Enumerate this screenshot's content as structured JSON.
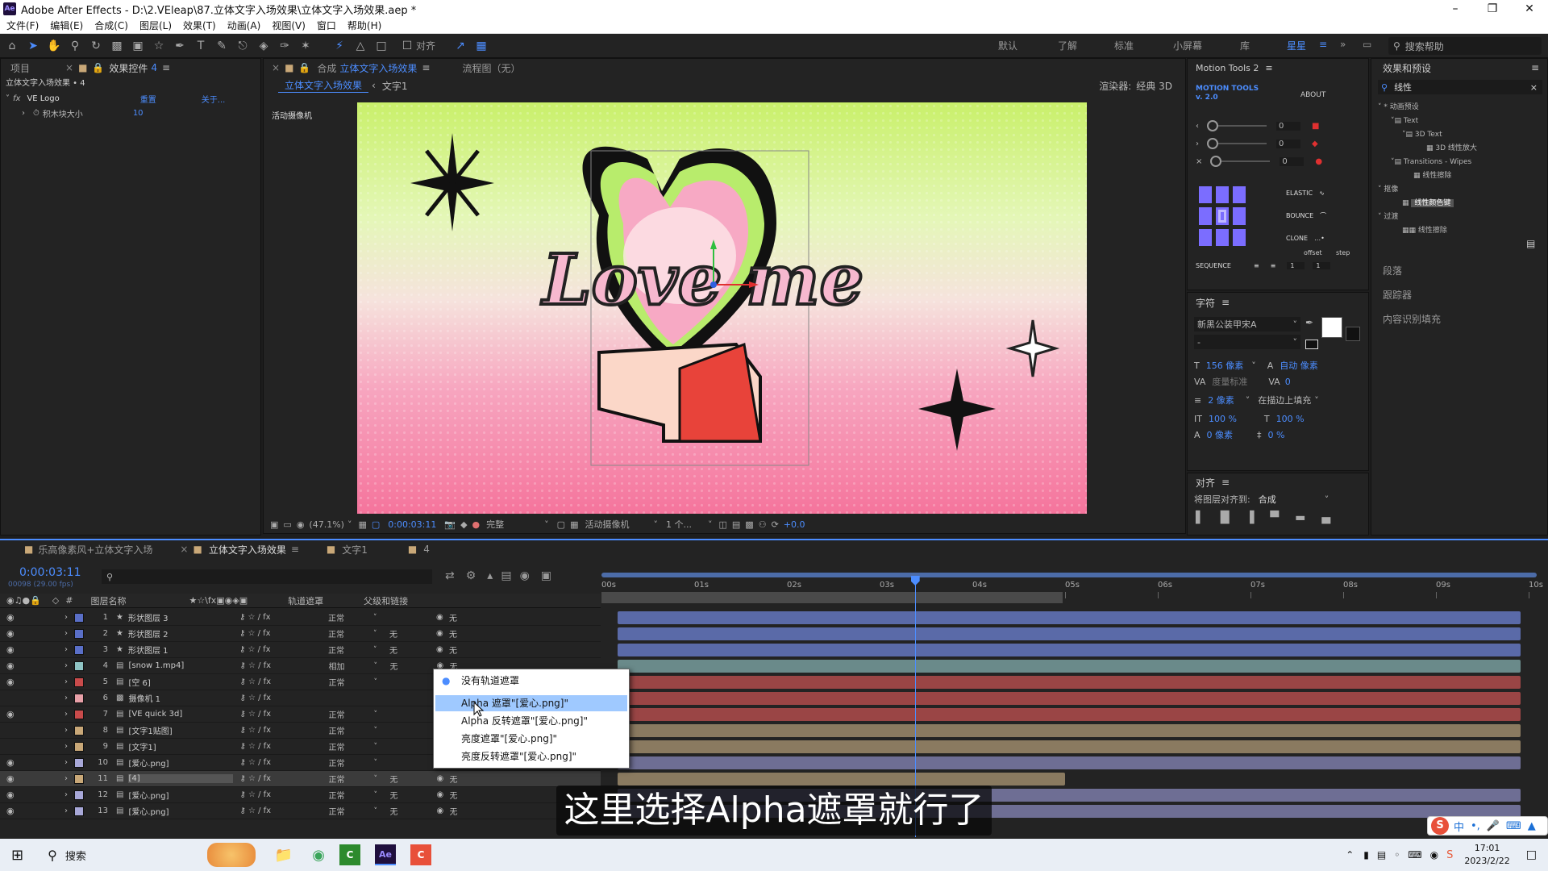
{
  "window": {
    "title": "Adobe After Effects - D:\\2.VEleap\\87.立体文字入场效果\\立体文字入场效果.aep *",
    "icon_label": "Ae"
  },
  "menu": [
    "文件(F)",
    "编辑(E)",
    "合成(C)",
    "图层(L)",
    "效果(T)",
    "动画(A)",
    "视图(V)",
    "窗口",
    "帮助(H)"
  ],
  "toolbar": {
    "align_label": "对齐",
    "workspaces": [
      "默认",
      "了解",
      "标准",
      "小屏幕",
      "库",
      "星星"
    ],
    "search_help": "搜索帮助"
  },
  "project_panel": {
    "tab_project": "项目",
    "tab_effects": "效果控件",
    "tab_effects_num": "4",
    "breadcrumb": "立体文字入场效果 • 4",
    "fx_name": "VE Logo",
    "fx_reset": "重置",
    "fx_about": "关于...",
    "prop_name": "积木块大小",
    "prop_value": "10"
  },
  "viewer": {
    "tab_label": "合成",
    "tab_comp": "立体文字入场效果",
    "tab_flow": "流程图（无）",
    "crumb_comp": "立体文字入场效果",
    "crumb_layer": "文字1",
    "renderer_label": "渲染器:",
    "renderer_value": "经典 3D",
    "camera_label": "活动摄像机",
    "canvas_text": "Love me",
    "zoom": "(47.1%)",
    "timecode": "0:00:03:11",
    "quality": "完整",
    "view_camera": "活动摄像机",
    "views": "1 个...",
    "exposure": "+0.0"
  },
  "motion_tools": {
    "title": "Motion Tools 2",
    "logo": "MOTION TOOLS v. 2.0",
    "about": "ABOUT",
    "slider_values": [
      "0",
      "0",
      "0"
    ],
    "elastic": "ELASTIC",
    "bounce": "BOUNCE",
    "clone": "CLONE",
    "offset": "offset",
    "step": "step",
    "sequence": "SEQUENCE",
    "seq_values": [
      "1",
      "1"
    ]
  },
  "character_panel": {
    "title": "字符",
    "font": "新黑公装甲宋A",
    "style": "-",
    "size": "156 像素",
    "leading": "自动 像素",
    "kerning": "度量标准",
    "tracking": "0",
    "stroke": "2 像素",
    "stroke_mode": "在描边上填充",
    "vscale": "100 %",
    "hscale": "100 %",
    "baseline": "0 像素",
    "tsume": "0 %"
  },
  "align_panel": {
    "title": "对齐",
    "align_to_label": "将图层对齐到:",
    "align_to_value": "合成"
  },
  "effects_presets": {
    "title": "效果和预设",
    "search_value": "线性",
    "tree": [
      "* 动画预设",
      "Text",
      "3D Text",
      "3D 线性放大",
      "Transitions - Wipes",
      "线性擦除",
      "抠像",
      "线性颜色键",
      "过渡",
      "线性擦除"
    ],
    "sections": [
      "段落",
      "跟踪器",
      "内容识别填充"
    ]
  },
  "timeline": {
    "tabs": [
      "乐高像素风+立体文字入场",
      "立体文字入场效果",
      "文字1",
      "4"
    ],
    "timecode": "0:00:03:11",
    "frame_info": "00098 (29.00 fps)",
    "col_layer_name": "图层名称",
    "col_track_matte": "轨道遮罩",
    "col_parent": "父级和链接",
    "ruler_labels": [
      "00s",
      "01s",
      "02s",
      "03s",
      "04s",
      "05s",
      "06s",
      "07s",
      "08s",
      "09s",
      "10s"
    ],
    "playhead_seconds": 3.38,
    "layers": [
      {
        "num": "1",
        "name": "形状图层 3",
        "color": "#5a6fc7",
        "mode": "正常",
        "matte": "",
        "parent": "无"
      },
      {
        "num": "2",
        "name": "形状图层 2",
        "color": "#5a6fc7",
        "mode": "正常",
        "matte": "无",
        "parent": "无"
      },
      {
        "num": "3",
        "name": "形状图层 1",
        "color": "#5a6fc7",
        "mode": "正常",
        "matte": "无",
        "parent": "无"
      },
      {
        "num": "4",
        "name": "[snow 1.mp4]",
        "color": "#8fc4c4",
        "mode": "相加",
        "matte": "无",
        "parent": "无"
      },
      {
        "num": "5",
        "name": "[空 6]",
        "color": "#c94b4b",
        "mode": "正常",
        "matte": "",
        "parent": ""
      },
      {
        "num": "6",
        "name": "摄像机 1",
        "color": "#e8a0a8",
        "mode": "",
        "matte": "",
        "parent": ""
      },
      {
        "num": "7",
        "name": "[VE quick 3d]",
        "color": "#c94b4b",
        "mode": "正常",
        "matte": "",
        "parent": ""
      },
      {
        "num": "8",
        "name": "[文字1贴图]",
        "color": "#c9a878",
        "mode": "正常",
        "matte": "",
        "parent": ""
      },
      {
        "num": "9",
        "name": "[文字1]",
        "color": "#c9a878",
        "mode": "正常",
        "matte": "",
        "parent": ""
      },
      {
        "num": "10",
        "name": "[爱心.png]",
        "color": "#a8a8d8",
        "mode": "正常",
        "matte": "",
        "parent": ""
      },
      {
        "num": "11",
        "name": "[4]",
        "color": "#c9a878",
        "mode": "正常",
        "matte": "无",
        "parent": "无"
      },
      {
        "num": "12",
        "name": "[爱心.png]",
        "color": "#a8a8d8",
        "mode": "正常",
        "matte": "无",
        "parent": "无"
      },
      {
        "num": "13",
        "name": "[爱心.png]",
        "color": "#a8a8d8",
        "mode": "正常",
        "matte": "无",
        "parent": "无"
      }
    ]
  },
  "dropdown": {
    "options": [
      "没有轨道遮罩",
      "Alpha 遮罩\"[爱心.png]\"",
      "Alpha 反转遮罩\"[爱心.png]\"",
      "亮度遮罩\"[爱心.png]\"",
      "亮度反转遮罩\"[爱心.png]\""
    ],
    "checked_index": 0,
    "highlight_index": 1
  },
  "subtitle": "这里选择Alpha遮罩就行了",
  "taskbar": {
    "search": "搜索",
    "time": "17:01",
    "date": "2023/2/22",
    "ime": "中"
  },
  "colors": {
    "accent": "#4c8dff",
    "panel_bg": "#232323",
    "canvas_top": "#c9f06a",
    "canvas_bottom": "#f5749c"
  }
}
